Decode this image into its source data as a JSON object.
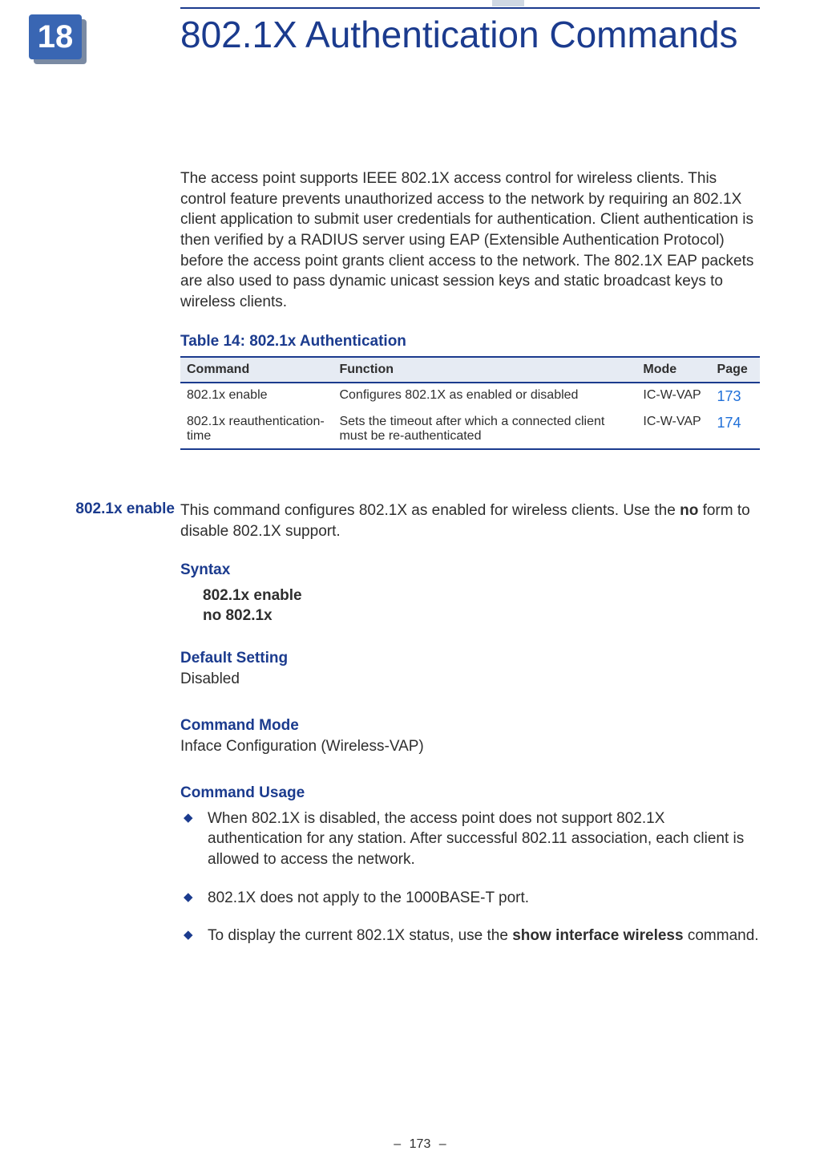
{
  "chapter": {
    "number": "18",
    "title": "802.1X Authentication Commands"
  },
  "intro": "The access point supports IEEE 802.1X access control for wireless clients. This control feature prevents unauthorized access to the network by requiring an 802.1X client application to submit user credentials for authentication. Client authentication is then verified by a RADIUS server using EAP (Extensible Authentication Protocol) before the access point grants client access to the network. The 802.1X EAP packets are also used to pass dynamic unicast session keys and static broadcast keys to wireless clients.",
  "table": {
    "caption": "Table 14: 802.1x Authentication",
    "headers": {
      "command": "Command",
      "function": "Function",
      "mode": "Mode",
      "page": "Page"
    },
    "rows": [
      {
        "command": "802.1x enable",
        "function": "Configures 802.1X as enabled or disabled",
        "mode": "IC-W-VAP",
        "page": "173"
      },
      {
        "command": "802.1x reauthentication-time",
        "function": "Sets the timeout after which a connected client must be re-authenticated",
        "mode": "IC-W-VAP",
        "page": "174"
      }
    ]
  },
  "command_detail": {
    "side_heading": "802.1x enable",
    "description_pre": "This command configures 802.1X as enabled for wireless clients. Use the ",
    "description_bold": "no",
    "description_post": " form to disable 802.1X support.",
    "syntax": {
      "label": "Syntax",
      "line1": "802.1x enable",
      "line2": "no 802.1x"
    },
    "default": {
      "label": "Default Setting",
      "value": "Disabled"
    },
    "mode": {
      "label": "Command Mode",
      "value": "Inface Configuration (Wireless-VAP)"
    },
    "usage": {
      "label": "Command Usage",
      "items": [
        {
          "pre": "When 802.1X is disabled, the access point does not support 802.1X authentication for any station. After successful 802.11 association, each client is allowed to access the network.",
          "bold": "",
          "post": ""
        },
        {
          "pre": "802.1X does not apply to the 1000BASE-T port.",
          "bold": "",
          "post": ""
        },
        {
          "pre": "To display the current 802.1X status, use the ",
          "bold": "show interface wireless",
          "post": " command."
        }
      ]
    }
  },
  "footer": {
    "dash": "–",
    "page": "173"
  }
}
